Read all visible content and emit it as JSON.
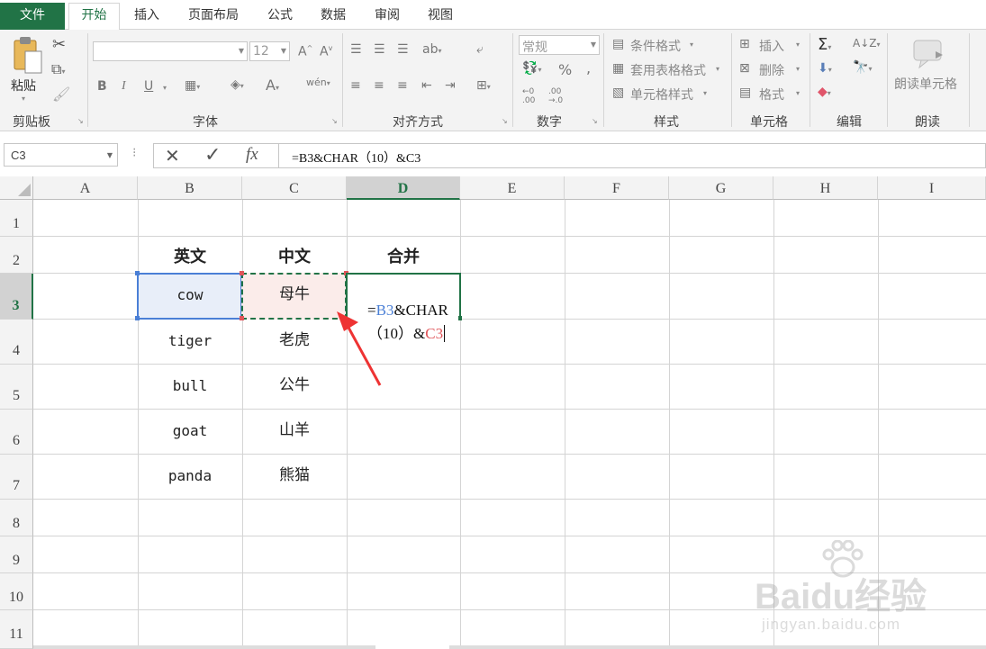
{
  "ribbon_tabs": [
    "文件",
    "开始",
    "插入",
    "页面布局",
    "公式",
    "数据",
    "审阅",
    "视图"
  ],
  "active_tab": "开始",
  "clipboard": {
    "paste": "粘贴",
    "label": "剪贴板"
  },
  "font": {
    "name": "",
    "size": "12",
    "bold": "B",
    "italic": "I",
    "underline": "U",
    "label": "字体"
  },
  "alignment": {
    "label": "对齐方式"
  },
  "number": {
    "format": "常规",
    "label": "数字"
  },
  "styles": {
    "conditional": "条件格式",
    "table": "套用表格格式",
    "cell_styles": "单元格样式",
    "label": "样式"
  },
  "cells": {
    "insert": "插入",
    "delete": "删除",
    "format": "格式",
    "label": "单元格"
  },
  "editing": {
    "label": "编辑"
  },
  "read": {
    "button": "朗读单元格",
    "label": "朗读"
  },
  "formula_bar": {
    "name_box": "C3",
    "cancel": "✕",
    "confirm": "✓",
    "fx": "fx",
    "formula": "=B3&CHAR（10）&C3"
  },
  "columns": [
    "A",
    "B",
    "C",
    "D",
    "E",
    "F",
    "G",
    "H",
    "I"
  ],
  "selected_column": "D",
  "rows": [
    "1",
    "2",
    "3",
    "4",
    "5",
    "6",
    "7",
    "8",
    "9",
    "10",
    "11"
  ],
  "selected_row": "3",
  "headers": {
    "b": "英文",
    "c": "中文",
    "d": "合并"
  },
  "data_rows": [
    {
      "en": "cow",
      "cn": "母牛"
    },
    {
      "en": "tiger",
      "cn": "老虎"
    },
    {
      "en": "bull",
      "cn": "公牛"
    },
    {
      "en": "goat",
      "cn": "山羊"
    },
    {
      "en": "panda",
      "cn": "熊猫"
    }
  ],
  "edit_cell": {
    "line1_eq": "=",
    "line1_ref": "B3",
    "line1_rest": "&CHAR",
    "line2_rest": "（10）&",
    "line2_ref": "C3"
  },
  "colors": {
    "accent": "#217346",
    "ref_b": "#4a7fd6",
    "ref_c": "#e0555a",
    "arrow": "#ee3333"
  },
  "watermark": {
    "brand": "Baidu经验",
    "url": "jingyan.baidu.com"
  }
}
